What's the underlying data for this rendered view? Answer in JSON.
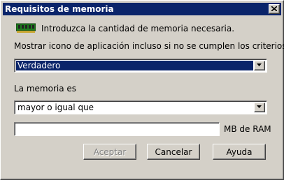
{
  "window": {
    "title": "Requisitos de memoria"
  },
  "info": {
    "text": "Introduzca la cantidad de memoria necesaria.",
    "icon": "memory-module-icon"
  },
  "criteria_option": {
    "label": "Mostrar icono de aplicación incluso si no se cumplen los criterios:",
    "selected": "Verdadero"
  },
  "memory_condition": {
    "label": "La memoria es",
    "selected": "mayor o igual que"
  },
  "ram_input": {
    "value": "",
    "unit": "MB de RAM"
  },
  "buttons": {
    "accept": "Aceptar",
    "cancel": "Cancelar",
    "help": "Ayuda"
  },
  "colors": {
    "titlebar": "#0a246a",
    "face": "#d4d0c8",
    "selection": "#0a246a"
  }
}
